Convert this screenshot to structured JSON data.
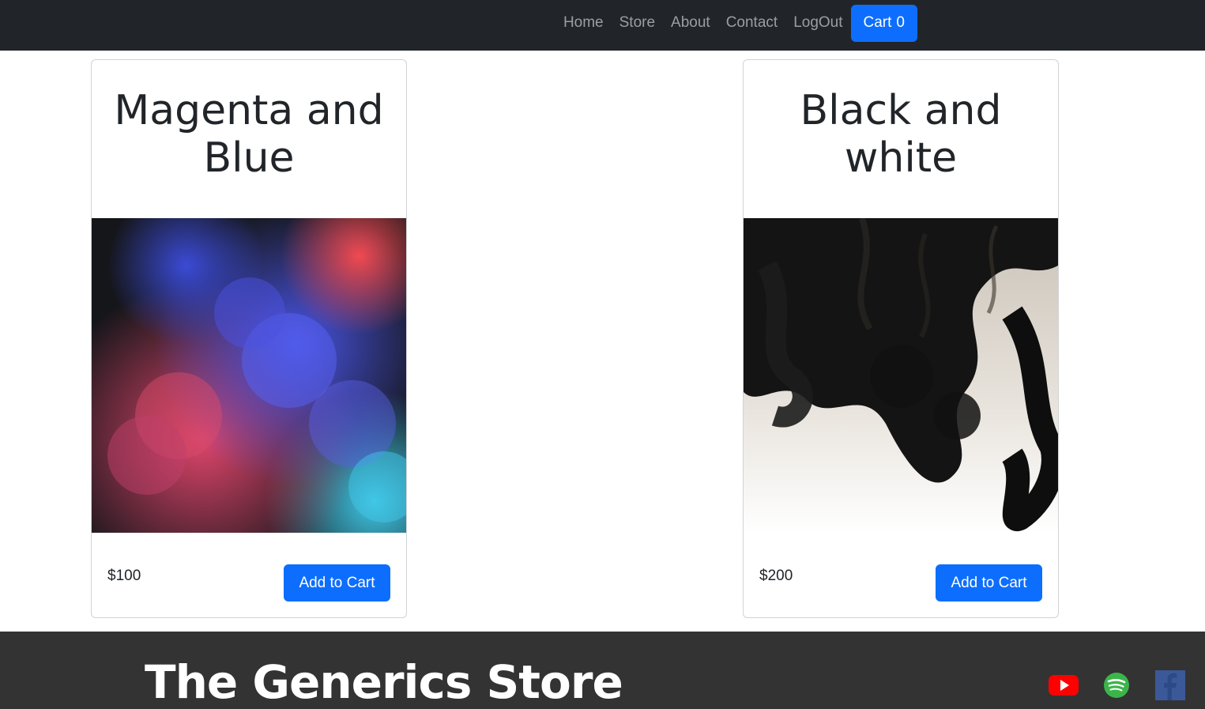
{
  "nav": {
    "links": [
      "Home",
      "Store",
      "About",
      "Contact",
      "LogOut"
    ],
    "cart_label": "Cart",
    "cart_count": "0"
  },
  "products": [
    {
      "title": "Magenta and Blue",
      "price": "$100",
      "button": "Add to Cart",
      "image_icon": "magenta-blue-smoke-image"
    },
    {
      "title": "Black and white",
      "price": "$200",
      "button": "Add to Cart",
      "image_icon": "black-white-smoke-image"
    }
  ],
  "footer": {
    "title": "The Generics Store",
    "social_icons": [
      "youtube-icon",
      "spotify-icon",
      "facebook-icon"
    ]
  },
  "colors": {
    "navbar": "#212529",
    "primary": "#0d6efd",
    "footer": "#333333"
  }
}
